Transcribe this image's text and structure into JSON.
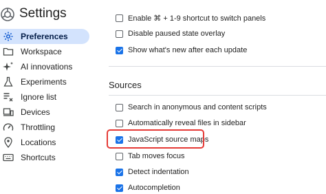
{
  "header": {
    "title": "Settings",
    "logo_icon": "devtools-gear-logo-icon"
  },
  "sidebar": {
    "items": [
      {
        "label": "Preferences",
        "icon": "gear-icon",
        "selected": true
      },
      {
        "label": "Workspace",
        "icon": "folder-icon",
        "selected": false
      },
      {
        "label": "AI innovations",
        "icon": "sparkle-icon",
        "selected": false
      },
      {
        "label": "Experiments",
        "icon": "flask-icon",
        "selected": false
      },
      {
        "label": "Ignore list",
        "icon": "ignore-list-icon",
        "selected": false
      },
      {
        "label": "Devices",
        "icon": "devices-icon",
        "selected": false
      },
      {
        "label": "Throttling",
        "icon": "gauge-icon",
        "selected": false
      },
      {
        "label": "Locations",
        "icon": "location-pin-icon",
        "selected": false
      },
      {
        "label": "Shortcuts",
        "icon": "keyboard-icon",
        "selected": false
      }
    ]
  },
  "appearance": {
    "options": [
      {
        "label": "Enable ⌘ + 1-9 shortcut to switch panels",
        "checked": false
      },
      {
        "label": "Disable paused state overlay",
        "checked": false
      },
      {
        "label": "Show what's new after each update",
        "checked": true
      }
    ]
  },
  "sources": {
    "title": "Sources",
    "options": [
      {
        "label": "Search in anonymous and content scripts",
        "checked": false
      },
      {
        "label": "Automatically reveal files in sidebar",
        "checked": false
      },
      {
        "label": "JavaScript source maps",
        "checked": true,
        "highlighted": true
      },
      {
        "label": "Tab moves focus",
        "checked": false
      },
      {
        "label": "Detect indentation",
        "checked": true
      },
      {
        "label": "Autocompletion",
        "checked": true
      }
    ]
  },
  "colors": {
    "accent": "#1a73e8",
    "selected_bg": "#d3e3fd",
    "highlight": "#e53935"
  }
}
